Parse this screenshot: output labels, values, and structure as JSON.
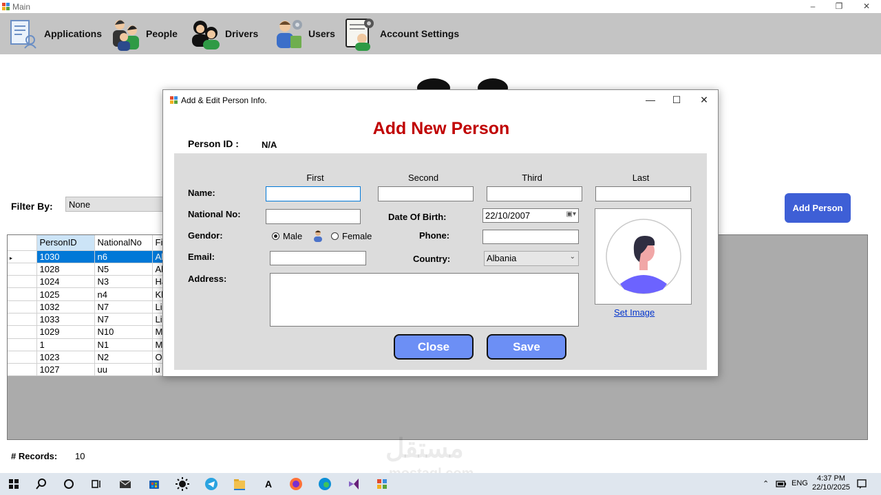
{
  "main_window": {
    "title": "Main",
    "controls": {
      "minimize": "–",
      "restore": "❐",
      "close": "✕"
    }
  },
  "menubar": {
    "items": [
      {
        "label": "Applications",
        "icon": "applications-icon"
      },
      {
        "label": "People",
        "icon": "people-icon"
      },
      {
        "label": "Drivers",
        "icon": "drivers-icon"
      },
      {
        "label": "Users",
        "icon": "users-icon"
      },
      {
        "label": "Account Settings",
        "icon": "account-settings-icon"
      }
    ]
  },
  "people_screen": {
    "filter_label": "Filter By:",
    "filter_value": "None",
    "add_person_label": "Add Person",
    "grid": {
      "columns": [
        "PersonID",
        "NationalNo",
        "Fi"
      ],
      "rows": [
        [
          "1030",
          "n6",
          "Al"
        ],
        [
          "1028",
          "N5",
          "Al"
        ],
        [
          "1024",
          "N3",
          "Ha"
        ],
        [
          "1025",
          "n4",
          "Kh"
        ],
        [
          "1032",
          "N7",
          "Lin"
        ],
        [
          "1033",
          "N7",
          "Lin"
        ],
        [
          "1029",
          "N10",
          "Ma"
        ],
        [
          "1",
          "N1",
          "Mo"
        ],
        [
          "1023",
          "N2",
          "Or"
        ],
        [
          "1027",
          "uu",
          "u"
        ]
      ],
      "selected_row": 0
    },
    "records_label": "# Records:",
    "records_value": "10"
  },
  "dialog": {
    "title": "Add & Edit Person Info.",
    "controls": {
      "minimize": "—",
      "maximize": "☐",
      "close": "✕"
    },
    "heading": "Add New Person",
    "person_id_label": "Person ID :",
    "person_id_value": "N/A",
    "name_columns": [
      "First",
      "Second",
      "Third",
      "Last"
    ],
    "labels": {
      "name": "Name:",
      "national_no": "National No:",
      "gender": "Gendor:",
      "email": "Email:",
      "address": "Address:",
      "date_of_birth": "Date Of Birth:",
      "phone": "Phone:",
      "country": "Country:"
    },
    "fields": {
      "first": "",
      "second": "",
      "third": "",
      "last": "",
      "national_no": "",
      "email": "",
      "phone": "",
      "address": "",
      "date_of_birth": "22/10/2007",
      "country": "Albania"
    },
    "gender_options": {
      "male": "Male",
      "female": "Female",
      "selected": "male"
    },
    "set_image_label": "Set Image",
    "close_label": "Close",
    "save_label": "Save",
    "colors": {
      "heading": "#c00000",
      "buttons": "#6c8ff5",
      "panel": "#dcdcdc"
    }
  },
  "taskbar": {
    "icons": [
      "windows-start-icon",
      "search-icon",
      "cortana-icon",
      "task-view-icon",
      "mail-icon",
      "store-icon",
      "brightness-icon",
      "telegram-icon",
      "file-explorer-icon",
      "font-app-icon",
      "firefox-icon",
      "edge-icon",
      "visual-studio-icon",
      "app-window-icon"
    ],
    "font_app_glyph": "A",
    "language": "ENG",
    "time": "4:37 PM",
    "date": "22/10/2025"
  }
}
